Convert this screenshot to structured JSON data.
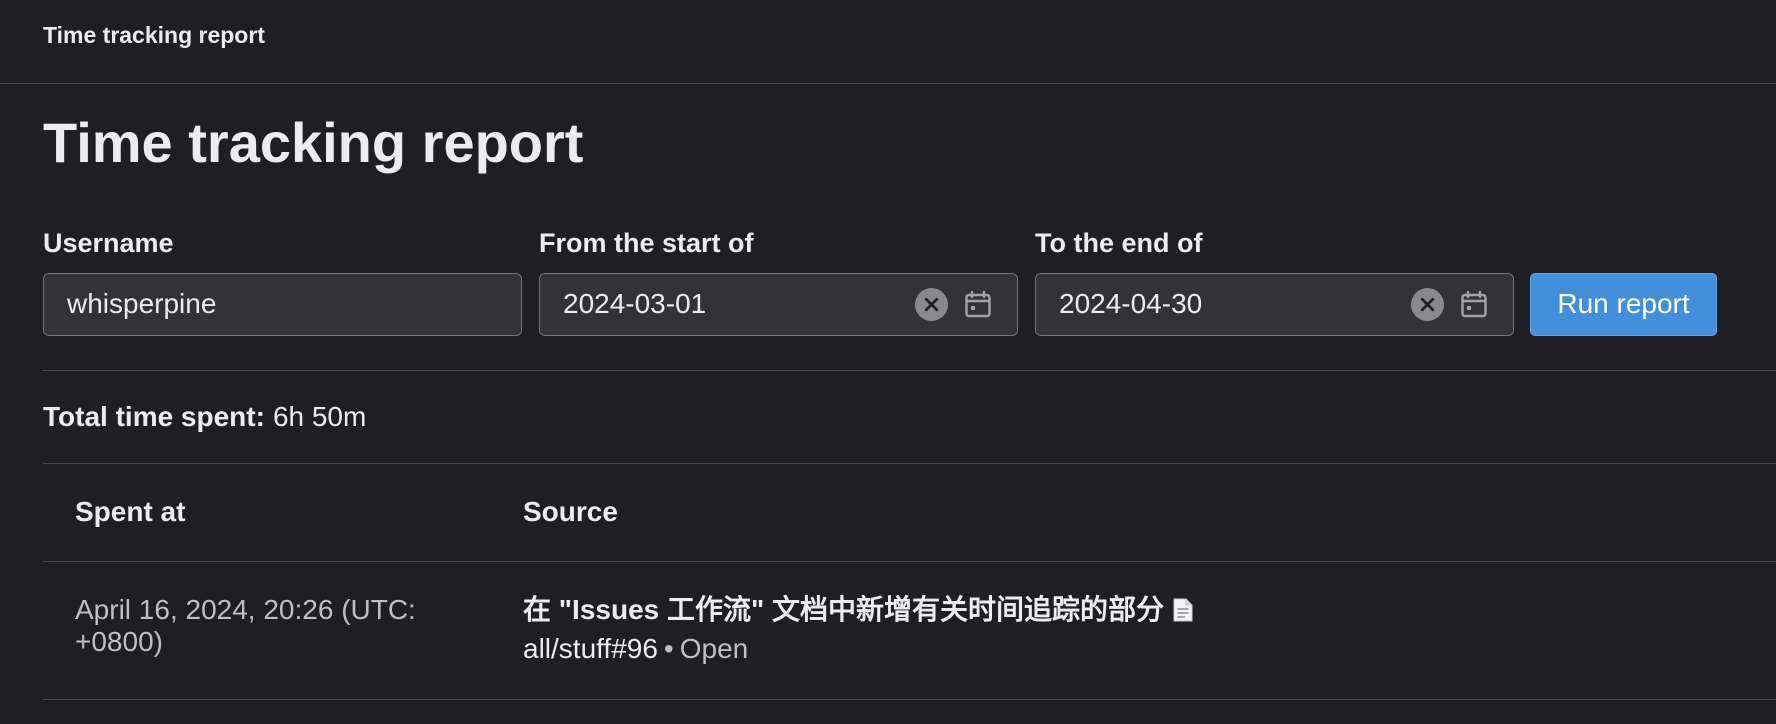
{
  "breadcrumb": "Time tracking report",
  "page_title": "Time tracking report",
  "form": {
    "username": {
      "label": "Username",
      "value": "whisperpine"
    },
    "from": {
      "label": "From the start of",
      "value": "2024-03-01"
    },
    "to": {
      "label": "To the end of",
      "value": "2024-04-30"
    },
    "run_button": "Run report"
  },
  "summary": {
    "label": "Total time spent:",
    "value": "6h 50m"
  },
  "table": {
    "headers": [
      "Spent at",
      "Source"
    ],
    "rows": [
      {
        "spent_at": "April 16, 2024, 20:26 (UTC: +0800)",
        "title": "在 \"Issues 工作流\" 文档中新增有关时间追踪的部分",
        "title_icon": "document-icon",
        "reference": "all/stuff#96",
        "separator": "•",
        "state": "Open"
      }
    ]
  },
  "colors": {
    "background": "#1f1f23",
    "input_bg": "#333238",
    "primary_button": "#428fdc",
    "text": "#ececef",
    "muted_text": "#bfbfc3",
    "divider": "#4a4a50"
  }
}
